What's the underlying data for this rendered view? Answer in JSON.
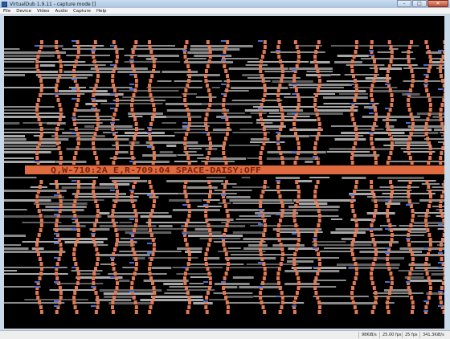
{
  "window": {
    "title": "VirtualDub 1.9.11 - capture mode []",
    "controls": {
      "minimize": "–",
      "maximize": "□",
      "close": "✕"
    }
  },
  "menu": [
    "File",
    "Device",
    "Video",
    "Audio",
    "Capture",
    "Help"
  ],
  "capture": {
    "banner_text": "Q,W-710:2A E,R-709:04 SPACE-DAISY:OFF",
    "colors": {
      "background": "#000000",
      "stripe": "#e07a55",
      "bar": "#8a8a8a",
      "banner": "#e06a40",
      "banner_text": "#7a2410",
      "accent": "#4a6fd0"
    }
  },
  "status": {
    "data_rate": "98KiB/s",
    "fps_actual": "25.00 fps",
    "fps_target": "25 fps",
    "size": "341.3KiB/s"
  }
}
